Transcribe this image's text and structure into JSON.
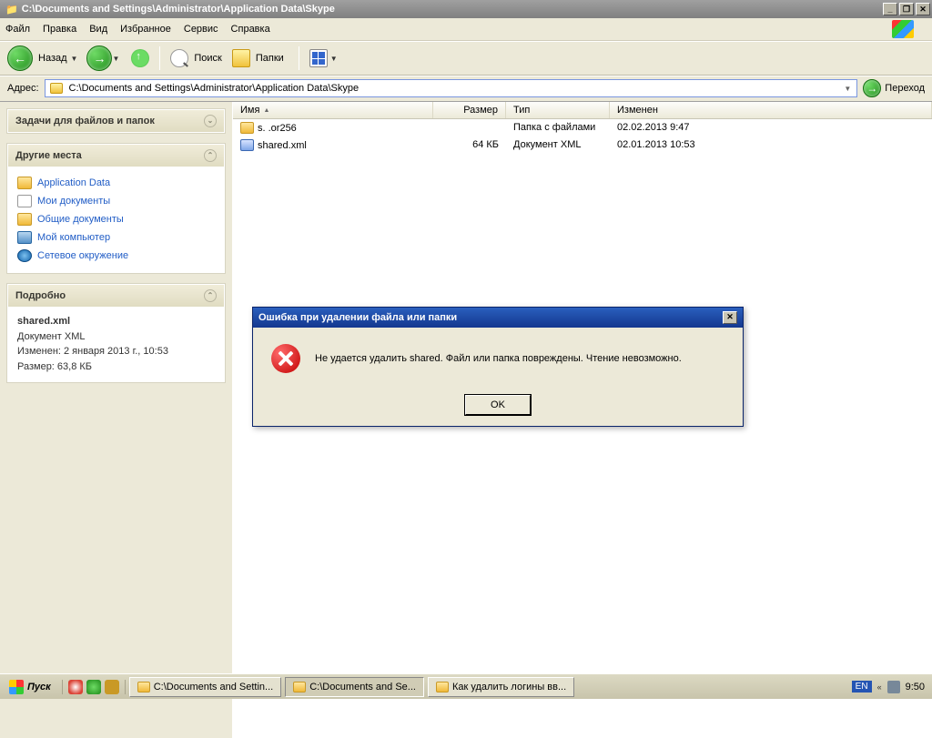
{
  "window": {
    "title": "C:\\Documents and Settings\\Administrator\\Application Data\\Skype"
  },
  "menu": {
    "file": "Файл",
    "edit": "Правка",
    "view": "Вид",
    "favorites": "Избранное",
    "tools": "Сервис",
    "help": "Справка"
  },
  "toolbar": {
    "back": "Назад",
    "search": "Поиск",
    "folders": "Папки"
  },
  "address": {
    "label": "Адрес:",
    "value": "C:\\Documents and Settings\\Administrator\\Application Data\\Skype",
    "go": "Переход"
  },
  "side": {
    "tasks_title": "Задачи для файлов и папок",
    "other_title": "Другие места",
    "places": [
      {
        "label": "Application Data",
        "icon": "folder"
      },
      {
        "label": "Мои документы",
        "icon": "docs"
      },
      {
        "label": "Общие документы",
        "icon": "folder"
      },
      {
        "label": "Мой компьютер",
        "icon": "pc"
      },
      {
        "label": "Сетевое окружение",
        "icon": "net"
      }
    ],
    "detail_title": "Подробно",
    "detail": {
      "filename": "shared.xml",
      "type": "Документ XML",
      "modified_label": "Изменен: 2 января 2013 г., 10:53",
      "size_label": "Размер: 63,8 КБ"
    }
  },
  "columns": {
    "name": "Имя",
    "size": "Размер",
    "type": "Тип",
    "modified": "Изменен"
  },
  "files": [
    {
      "icon": "folder",
      "name": "s.   .or256",
      "size": "",
      "type": "Папка с файлами",
      "modified": "02.02.2013 9:47"
    },
    {
      "icon": "xml",
      "name": "shared.xml",
      "size": "64 КБ",
      "type": "Документ XML",
      "modified": "02.01.2013 10:53"
    }
  ],
  "dialog": {
    "title": "Ошибка при удалении файла или папки",
    "message": "Не удается удалить shared. Файл или папка повреждены. Чтение невозможно.",
    "ok": "OK"
  },
  "taskbar": {
    "start": "Пуск",
    "tasks": [
      "C:\\Documents and Settin...",
      "C:\\Documents and Se...",
      "Как удалить логины вв..."
    ],
    "lang": "EN",
    "time": "9:50"
  }
}
